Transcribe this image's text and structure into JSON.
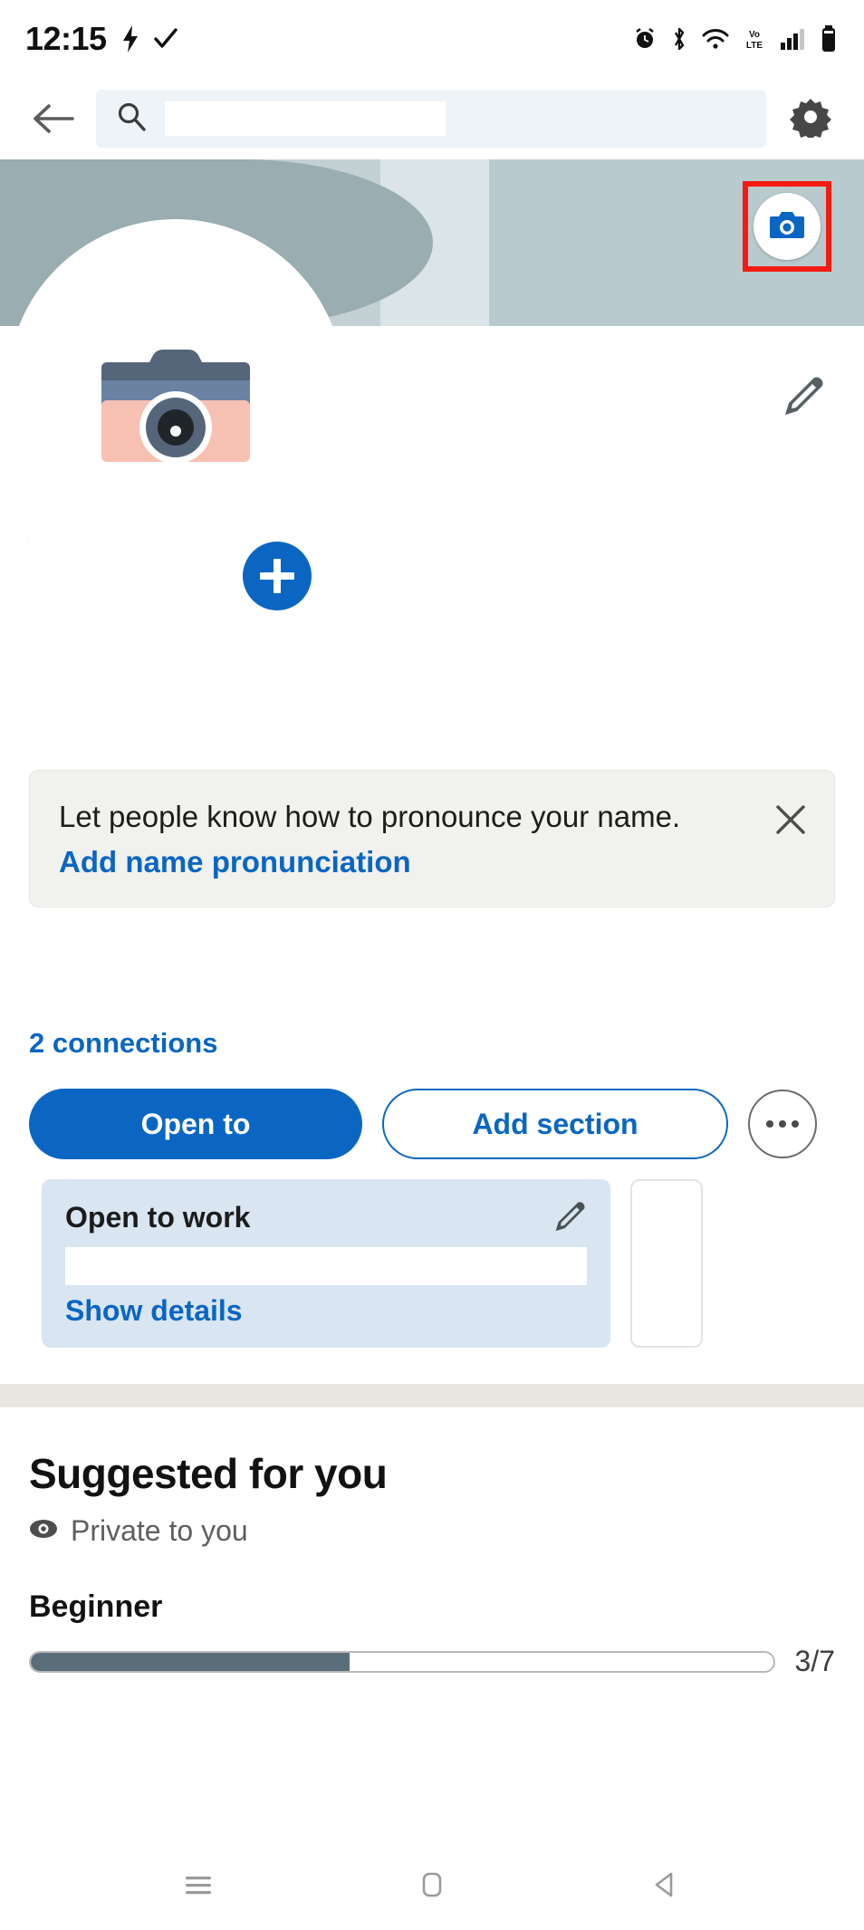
{
  "status_bar": {
    "time": "12:15",
    "icons_left": [
      "flash-icon",
      "checkmark-icon"
    ],
    "icons_right": [
      "alarm-icon",
      "bluetooth-icon",
      "wifi-icon",
      "volte-icon",
      "signal-icon",
      "battery-icon"
    ]
  },
  "top_nav": {
    "back_icon": "back-arrow-icon",
    "search_icon": "search-icon",
    "search_value": "",
    "search_placeholder": "",
    "settings_icon": "gear-icon"
  },
  "cover": {
    "camera_button_icon": "camera-icon",
    "highlight_color": "#f41c12",
    "accent_blue": "#0a66c2"
  },
  "profile": {
    "avatar_icon": "camera-placeholder-icon",
    "add_photo_icon": "plus-icon",
    "edit_icon": "pencil-icon"
  },
  "pronunciation_card": {
    "text": "Let people know how to pronounce your name.",
    "link": "Add name pronunciation",
    "close_icon": "close-icon"
  },
  "connections": {
    "label": "2 connections"
  },
  "actions": {
    "primary_label": "Open to",
    "secondary_label": "Add section",
    "more_icon": "ellipsis-icon"
  },
  "open_to_work": {
    "title": "Open to work",
    "detail_value": "",
    "link": "Show details",
    "edit_icon": "pencil-icon"
  },
  "suggested": {
    "title": "Suggested for you",
    "privacy_icon": "eye-icon",
    "privacy_label": "Private to you",
    "level": "Beginner",
    "progress_label": "3/7",
    "progress_current": 3,
    "progress_total": 7,
    "progress_percent": 43
  },
  "system_nav": {
    "recents_icon": "menu-icon",
    "home_icon": "home-square-icon",
    "back_icon": "back-triangle-icon"
  }
}
